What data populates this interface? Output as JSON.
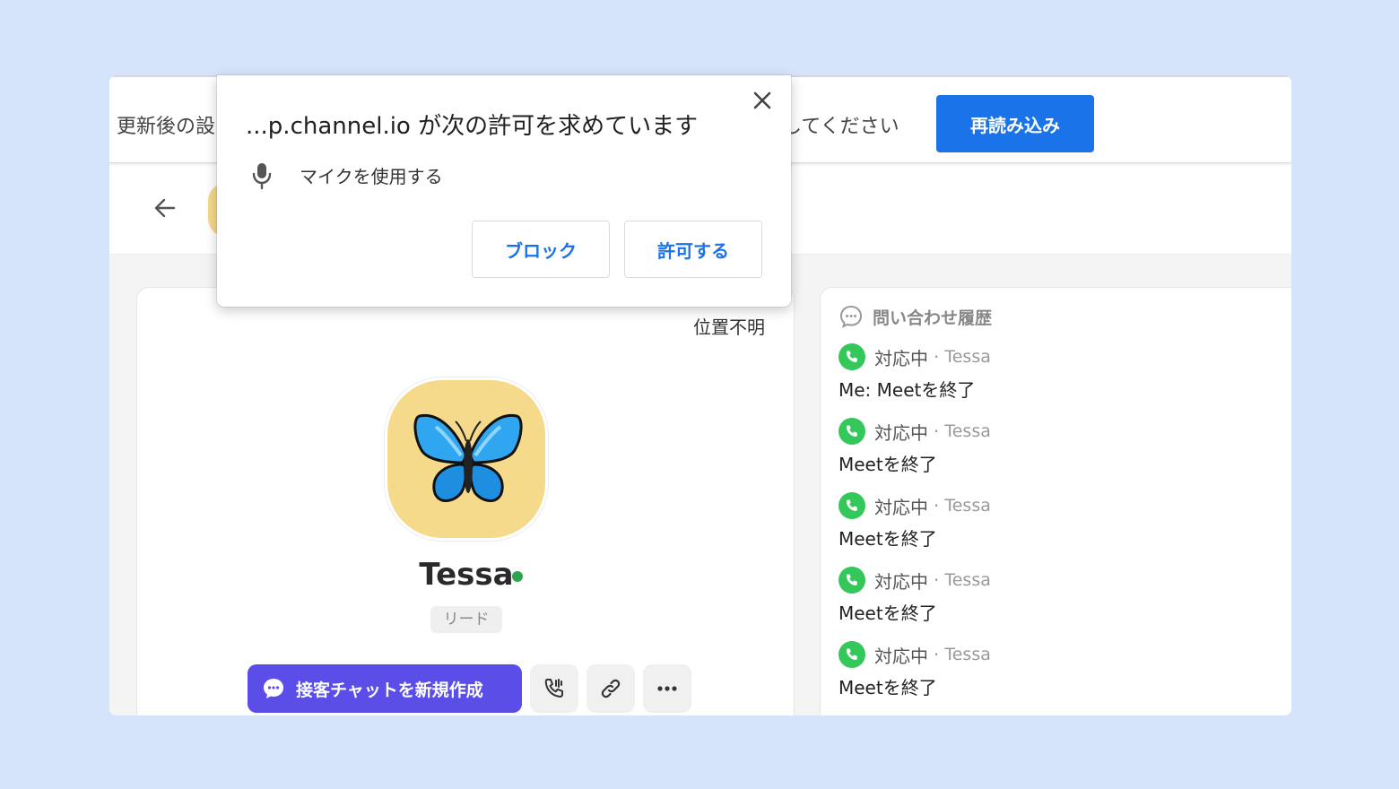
{
  "infobar": {
    "text_start": "更新後の設",
    "text_end": "してください",
    "reload_label": "再読み込み"
  },
  "dialog": {
    "title": "...p.channel.io が次の許可を求めています",
    "permission_icon": "microphone-icon",
    "permission_text": "マイクを使用する",
    "block_label": "ブロック",
    "allow_label": "許可する"
  },
  "profile": {
    "location": "位置不明",
    "name": "Tessa",
    "tag": "リード",
    "new_chat_label": "接客チャットを新規作成",
    "avatar_emoji": "butterfly"
  },
  "history": {
    "title": "問い合わせ履歴",
    "items": [
      {
        "status": "対応中",
        "who": "Tessa",
        "message": "Me: Meetを終了"
      },
      {
        "status": "対応中",
        "who": "Tessa",
        "message": "Meetを終了"
      },
      {
        "status": "対応中",
        "who": "Tessa",
        "message": "Meetを終了"
      },
      {
        "status": "対応中",
        "who": "Tessa",
        "message": "Meetを終了"
      },
      {
        "status": "対応中",
        "who": "Tessa",
        "message": "Meetを終了"
      }
    ]
  },
  "colors": {
    "background": "#d6e4fb",
    "accent_blue": "#1a73e8",
    "primary_purple": "#5a4de8",
    "online_green": "#2ea44f",
    "phone_green": "#34c759"
  }
}
